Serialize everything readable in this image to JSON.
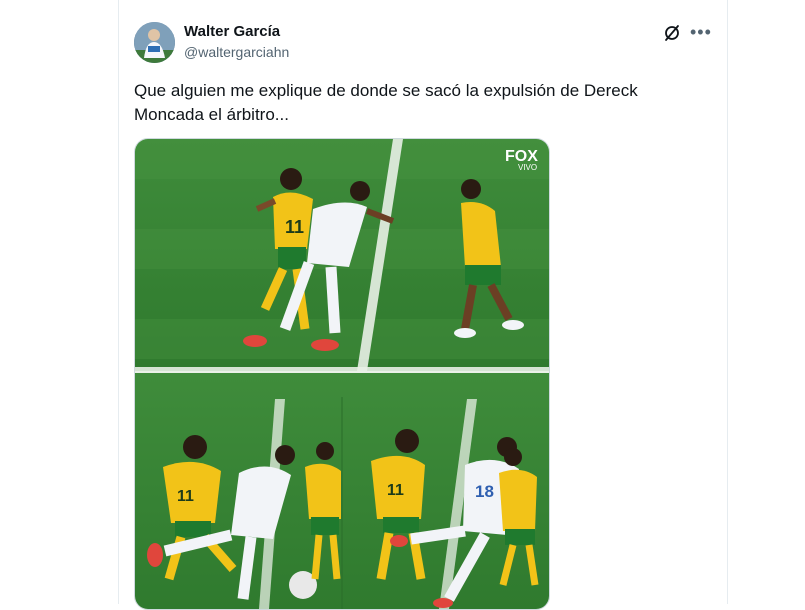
{
  "post": {
    "author_name": "Walter García",
    "author_handle": "@waltergarciahn",
    "text": "Que alguien me explique de donde se sacó la expulsión de Dereck\nMoncada el árbitro...",
    "more_icon": "more-dots-icon",
    "grok_icon": "grok-icon",
    "media": {
      "watermark_brand": "FOX",
      "watermark_sub": "VIVO",
      "jersey_yellow_number": "11",
      "jersey_white_number": "18"
    }
  },
  "colors": {
    "text_primary": "#0f1419",
    "text_secondary": "#536471",
    "pitch_green": "#3d8a3a",
    "jamaica_yellow": "#f2c318",
    "honduras_white": "#f2f4f8"
  }
}
